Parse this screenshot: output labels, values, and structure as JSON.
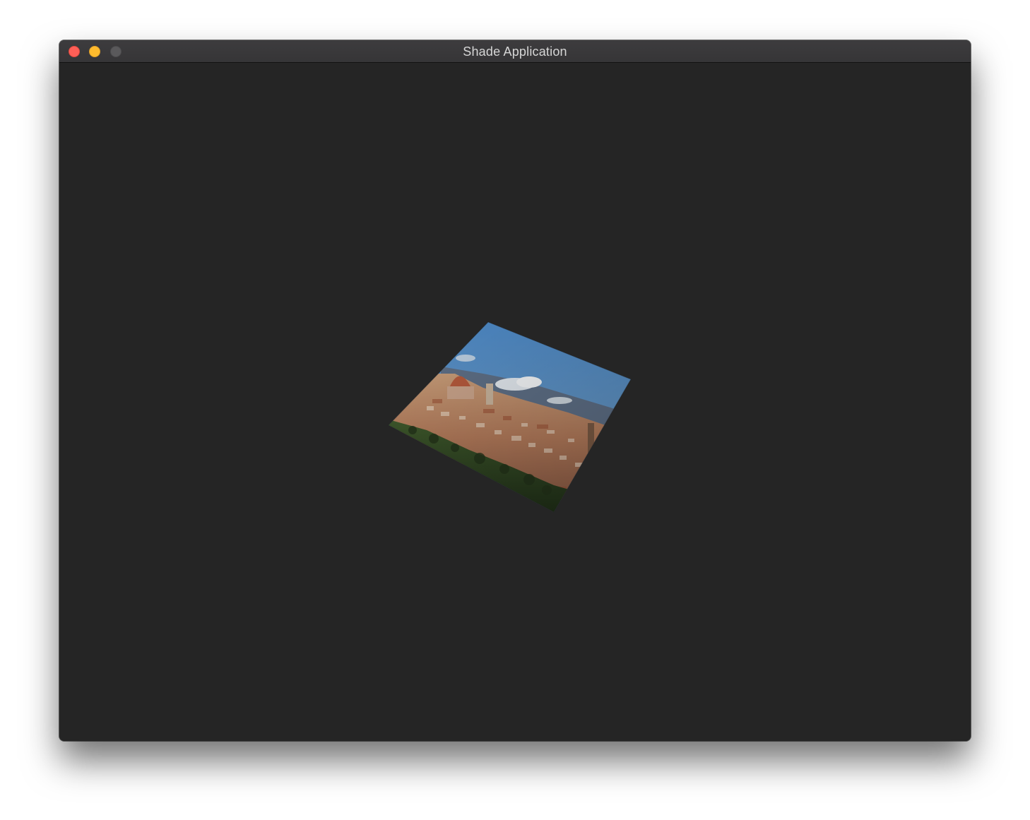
{
  "window": {
    "title": "Shade Application",
    "background_color": "#252525",
    "titlebar_buttons": [
      {
        "name": "close",
        "color": "#fe5f57"
      },
      {
        "name": "minimize",
        "color": "#febb2e"
      },
      {
        "name": "zoom",
        "color": "#5a595b"
      }
    ]
  },
  "viewport": {
    "content": "perspective-rendered textured quad (Florence cityscape photo)"
  }
}
